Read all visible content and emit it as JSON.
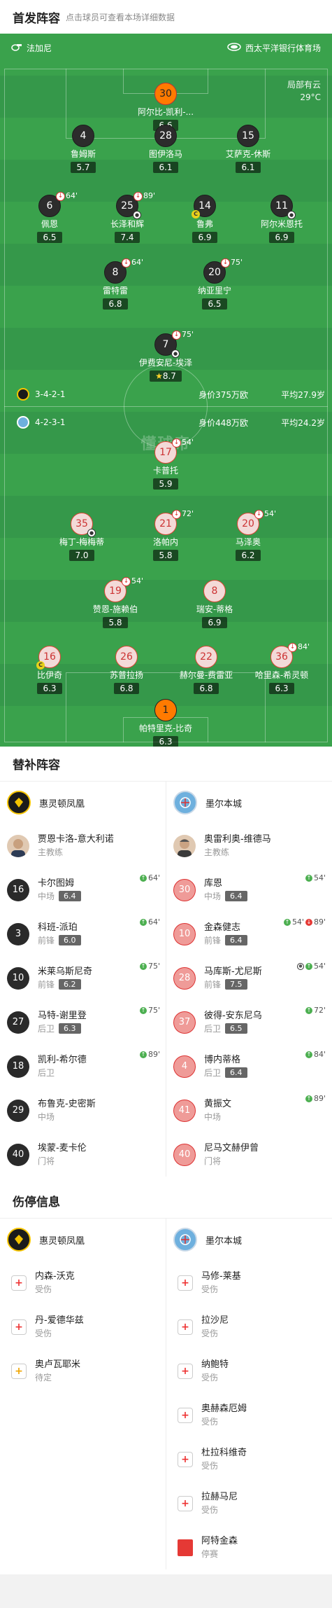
{
  "lineup_header": {
    "title": "首发阵容",
    "subtitle": "点击球员可查看本场详细数据"
  },
  "match_info": {
    "referee_icon": "whistle-icon",
    "referee": "法加尼",
    "venue_icon": "stadium-icon",
    "venue": "西太平洋银行体育场",
    "weather_desc": "局部有云",
    "temperature": "29°C",
    "watermark": "懂球帝"
  },
  "away_team": {
    "name": "墨尔本城",
    "formation": "4-2-3-1",
    "market_value": "身价448万欧",
    "avg_age": "平均24.2岁",
    "players": [
      {
        "num": "30",
        "name": "阿尔比-凯利-...",
        "rating": "6.6",
        "gk": true
      },
      {
        "num": "4",
        "name": "鲁姆斯",
        "rating": "5.7"
      },
      {
        "num": "28",
        "name": "图伊洛马",
        "rating": "6.1"
      },
      {
        "num": "15",
        "name": "艾萨克-休斯",
        "rating": "6.1"
      },
      {
        "num": "6",
        "name": "佩恩",
        "rating": "6.5",
        "sub_min": "64'"
      },
      {
        "num": "25",
        "name": "长泽和辉",
        "rating": "7.4",
        "sub_min": "89'"
      },
      {
        "num": "14",
        "name": "鲁弗",
        "rating": "6.9"
      },
      {
        "num": "11",
        "name": "阿尔米恩托",
        "rating": "6.9"
      },
      {
        "num": "8",
        "name": "雷特雷",
        "rating": "6.8",
        "sub_min": "64'"
      },
      {
        "num": "20",
        "name": "纳亚里宁",
        "rating": "6.5",
        "sub_min": "75'"
      },
      {
        "num": "7",
        "name": "伊费安尼-埃泽",
        "rating": "8.7",
        "sub_min": "75'"
      }
    ]
  },
  "home_team": {
    "name": "惠灵顿凤凰",
    "formation": "3-4-2-1",
    "market_value": "身价375万欧",
    "avg_age": "平均27.9岁",
    "players": [
      {
        "num": "17",
        "name": "卡普托",
        "rating": "5.9",
        "sub_min": "54'"
      },
      {
        "num": "35",
        "name": "梅丁-梅梅蒂",
        "rating": "7.0"
      },
      {
        "num": "21",
        "name": "洛帕内",
        "rating": "5.8",
        "sub_min": "72'"
      },
      {
        "num": "20",
        "name": "马泽奥",
        "rating": "6.2",
        "sub_min": "54'"
      },
      {
        "num": "19",
        "name": "赞恩-施赖伯",
        "rating": "5.8",
        "sub_min": "54'"
      },
      {
        "num": "8",
        "name": "瑞安-蒂格",
        "rating": "6.9"
      },
      {
        "num": "16",
        "name": "比伊奇",
        "rating": "6.3"
      },
      {
        "num": "26",
        "name": "苏普拉扬",
        "rating": "6.8"
      },
      {
        "num": "22",
        "name": "赫尔曼-费雷亚",
        "rating": "6.8"
      },
      {
        "num": "36",
        "name": "哈里森-希灵顿",
        "rating": "6.3",
        "sub_min": "84'"
      },
      {
        "num": "1",
        "name": "帕特里克-比奇",
        "rating": "6.3",
        "gk": true
      }
    ]
  },
  "subs_section": {
    "title": "替补阵容",
    "home_team": "惠灵顿凤凰",
    "away_team": "墨尔本城",
    "home_coach": {
      "name": "贾恩卡洛-意大利诺",
      "role": "主教练"
    },
    "away_coach": {
      "name": "奥雷利奥-维德马",
      "role": "主教练"
    },
    "home": [
      {
        "num": "16",
        "name": "卡尔图姆",
        "pos": "中场",
        "rating": "6.4",
        "events": [
          "64'"
        ]
      },
      {
        "num": "3",
        "name": "科班-派珀",
        "pos": "前锋",
        "rating": "6.0",
        "events": [
          "64'"
        ]
      },
      {
        "num": "10",
        "name": "米莱乌斯尼奇",
        "pos": "前锋",
        "rating": "6.2",
        "events": [
          "75'"
        ]
      },
      {
        "num": "27",
        "name": "马特-谢里登",
        "pos": "后卫",
        "rating": "6.3",
        "events": [
          "75'"
        ]
      },
      {
        "num": "18",
        "name": "凯利-希尔德",
        "pos": "后卫",
        "rating": "",
        "events": [
          "89'"
        ]
      },
      {
        "num": "29",
        "name": "布鲁克-史密斯",
        "pos": "中场",
        "rating": "",
        "events": []
      },
      {
        "num": "40",
        "name": "埃蒙-麦卡伦",
        "pos": "门将",
        "rating": "",
        "events": []
      }
    ],
    "away": [
      {
        "num": "30",
        "name": "库恩",
        "pos": "中场",
        "rating": "6.4",
        "events": [
          "54'"
        ]
      },
      {
        "num": "10",
        "name": "金森健志",
        "pos": "前锋",
        "rating": "6.4",
        "events": [
          "54'",
          "89'"
        ]
      },
      {
        "num": "28",
        "name": "马库斯-尤尼斯",
        "pos": "前锋",
        "rating": "7.5",
        "events": [
          "54'"
        ]
      },
      {
        "num": "37",
        "name": "彼得-安东尼乌",
        "pos": "后卫",
        "rating": "6.5",
        "events": [
          "72'"
        ]
      },
      {
        "num": "4",
        "name": "博内蒂格",
        "pos": "后卫",
        "rating": "6.4",
        "events": [
          "84'"
        ]
      },
      {
        "num": "41",
        "name": "黄振文",
        "pos": "中场",
        "rating": "",
        "events": [
          "89'"
        ]
      },
      {
        "num": "40",
        "name": "尼马文赫伊曾",
        "pos": "门将",
        "rating": "",
        "events": []
      }
    ]
  },
  "injury_section": {
    "title": "伤停信息",
    "home_team": "惠灵顿凤凰",
    "away_team": "墨尔本城",
    "home": [
      {
        "name": "内森-沃克",
        "status": "受伤",
        "type": "injury"
      },
      {
        "name": "丹-爱德华兹",
        "status": "受伤",
        "type": "injury"
      },
      {
        "name": "奥卢瓦耶米",
        "status": "待定",
        "type": "pending"
      }
    ],
    "away": [
      {
        "name": "马修-莱基",
        "status": "受伤",
        "type": "injury"
      },
      {
        "name": "拉沙尼",
        "status": "受伤",
        "type": "injury"
      },
      {
        "name": "纳鲍特",
        "status": "受伤",
        "type": "injury"
      },
      {
        "name": "奥赫森厄姆",
        "status": "受伤",
        "type": "injury"
      },
      {
        "name": "杜拉科维奇",
        "status": "受伤",
        "type": "injury"
      },
      {
        "name": "拉赫马尼",
        "status": "受伤",
        "type": "injury"
      },
      {
        "name": "阿特金森",
        "status": "停赛",
        "type": "suspension"
      }
    ]
  },
  "colors": {
    "pitch": "#3aa24c",
    "away_accent": "#d33333",
    "home_accent": "#f5c400"
  }
}
